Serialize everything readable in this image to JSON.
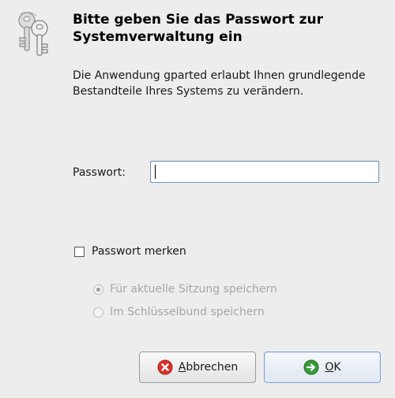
{
  "dialog": {
    "title": "Bitte geben Sie das Passwort zur Systemverwaltung ein",
    "description": "Die Anwendung gparted erlaubt Ihnen grundlegende Bestandteile Ihres Systems zu verändern.",
    "icon": "keys-icon"
  },
  "password": {
    "label": "Passwort:",
    "value": ""
  },
  "remember": {
    "label": "Passwort merken",
    "checked": false
  },
  "storage_options": [
    {
      "label": "Für aktuelle Sitzung speichern",
      "selected": true,
      "enabled": false
    },
    {
      "label": "Im Schlüsselbund speichern",
      "selected": false,
      "enabled": false
    }
  ],
  "buttons": {
    "cancel": {
      "mnemonic": "A",
      "rest": "bbrechen",
      "icon": "cancel-icon"
    },
    "ok": {
      "mnemonic": "O",
      "rest": "K",
      "icon": "ok-arrow-icon"
    }
  },
  "colors": {
    "background": "#ededed",
    "input_focus_border": "#6e8fbf",
    "cancel_icon": "#d9322b",
    "ok_icon": "#3a9a3a"
  }
}
